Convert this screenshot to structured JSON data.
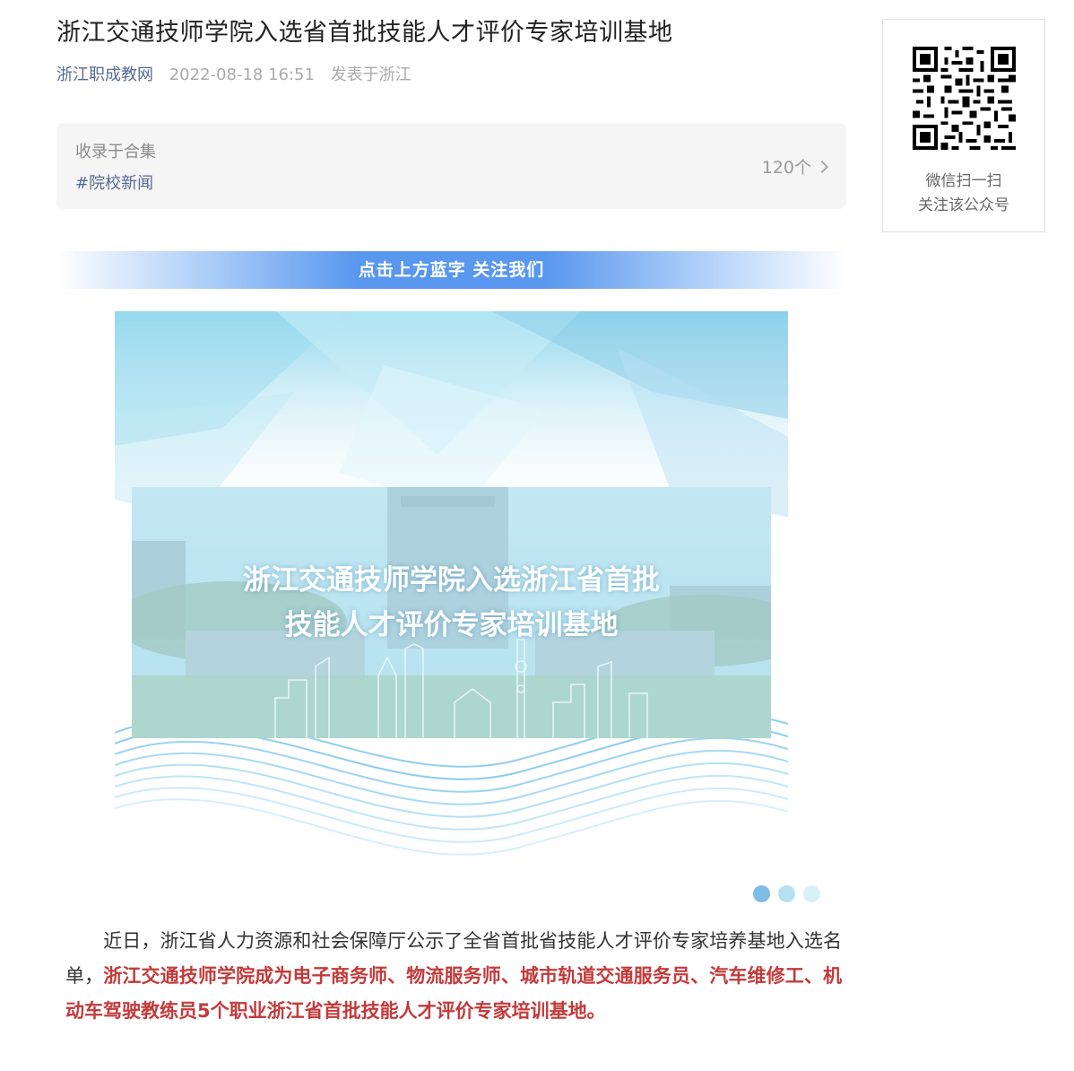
{
  "article": {
    "title": "浙江交通技师学院入选省首批技能人才评价专家培训基地",
    "account_name": "浙江职成教网",
    "publish_time": "2022-08-18 16:51",
    "location": "发表于浙江"
  },
  "collection": {
    "label": "收录于合集",
    "tag": "#院校新闻",
    "count": "120个"
  },
  "qr": {
    "line1": "微信扫一扫",
    "line2": "关注该公众号"
  },
  "follow_banner": "点击上方蓝字 关注我们",
  "hero": {
    "line1": "浙江交通技师学院入选浙江省首批",
    "line2": "技能人才评价专家培训基地"
  },
  "carousel": {
    "dot_colors": [
      "#7dbde6",
      "#b3e1f2",
      "#d8f1f9"
    ]
  },
  "body": {
    "text_normal": "近日，浙江省人力资源和社会保障厅公示了全省首批省技能人才评价专家培养基地入选名单，",
    "text_bold": "浙江交通技师学院成为电子商务师、物流服务师、城市轨道交通服务员、汽车维修工、机动车驾驶教练员5个职业浙江省首批技能人才评价专家培训基地。"
  }
}
